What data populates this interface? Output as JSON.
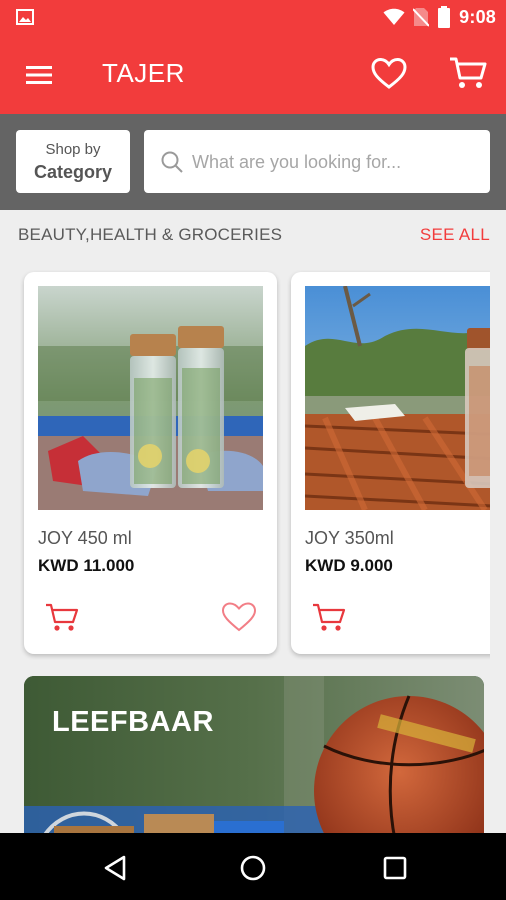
{
  "status_bar": {
    "time": "9:08",
    "icons": [
      "gallery-icon",
      "wifi-icon",
      "no-sim-icon",
      "battery-icon"
    ]
  },
  "app_bar": {
    "title": "TAJER",
    "icons": [
      "menu-icon",
      "heart-icon",
      "cart-icon"
    ]
  },
  "search": {
    "category_button_line1": "Shop by",
    "category_button_line2": "Category",
    "placeholder": "What are you looking for..."
  },
  "section": {
    "title": "BEAUTY,HEALTH & GROCERIES",
    "see_all": "SEE ALL"
  },
  "products": [
    {
      "name": "JOY 450 ml",
      "price": "KWD 11.000"
    },
    {
      "name": "JOY 350ml",
      "price": "KWD 9.000"
    }
  ],
  "banner": {
    "brand": "LEEFBAAR"
  },
  "nav_bar": {
    "buttons": [
      "back-icon",
      "home-icon",
      "recents-icon"
    ]
  },
  "colors": {
    "accent": "#f23c3c",
    "search_strip": "#646464",
    "background": "#eeeeee"
  }
}
